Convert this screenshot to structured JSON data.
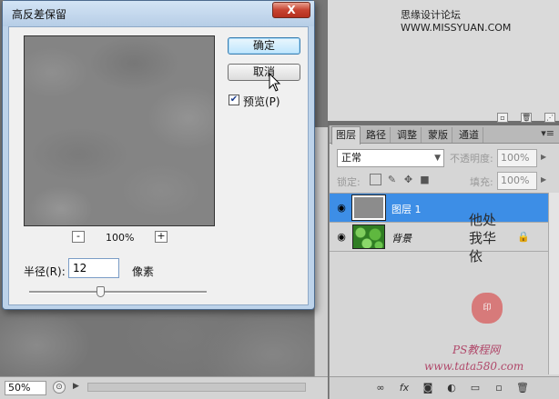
{
  "dialog": {
    "title": "高反差保留",
    "close_label": "X",
    "ok_label": "确定",
    "cancel_label": "取消",
    "preview_label": "预览(P)",
    "preview_checked": true,
    "zoom_out_label": "-",
    "zoom_in_label": "+",
    "zoom_level": "100%",
    "radius_label": "半径(R):",
    "radius_value": "12",
    "radius_unit": "像素",
    "slider_position": 0.4
  },
  "canvas": {
    "zoom_field": "50%"
  },
  "watermarks": {
    "top": "思缘设计论坛 WWW.MISSYUAN.COM",
    "handwriting": "他处我华依",
    "seal": "印",
    "bottom_1": "PS教程网",
    "bottom_2": "www.tata580.com"
  },
  "layers_panel": {
    "tabs": [
      "图层",
      "路径",
      "调整",
      "蒙版",
      "通道"
    ],
    "active_tab": "图层",
    "blend_mode": "正常",
    "opacity_label": "不透明度:",
    "opacity_value": "100%",
    "lock_label": "锁定:",
    "fill_label": "填充:",
    "fill_value": "100%",
    "layers": [
      {
        "name": "图层 1",
        "selected": true,
        "thumb": "gray",
        "italic": false,
        "locked": false
      },
      {
        "name": "背景",
        "selected": false,
        "thumb": "green",
        "italic": true,
        "locked": true
      }
    ],
    "footer_icons": [
      "link-icon",
      "fx-icon",
      "mask-icon",
      "adjustment-icon",
      "group-icon",
      "new-layer-icon",
      "trash-icon"
    ]
  },
  "colors": {
    "selection": "#3d8ee6",
    "dialog_frame": "#bdd3ea",
    "close_button": "#c74331"
  }
}
